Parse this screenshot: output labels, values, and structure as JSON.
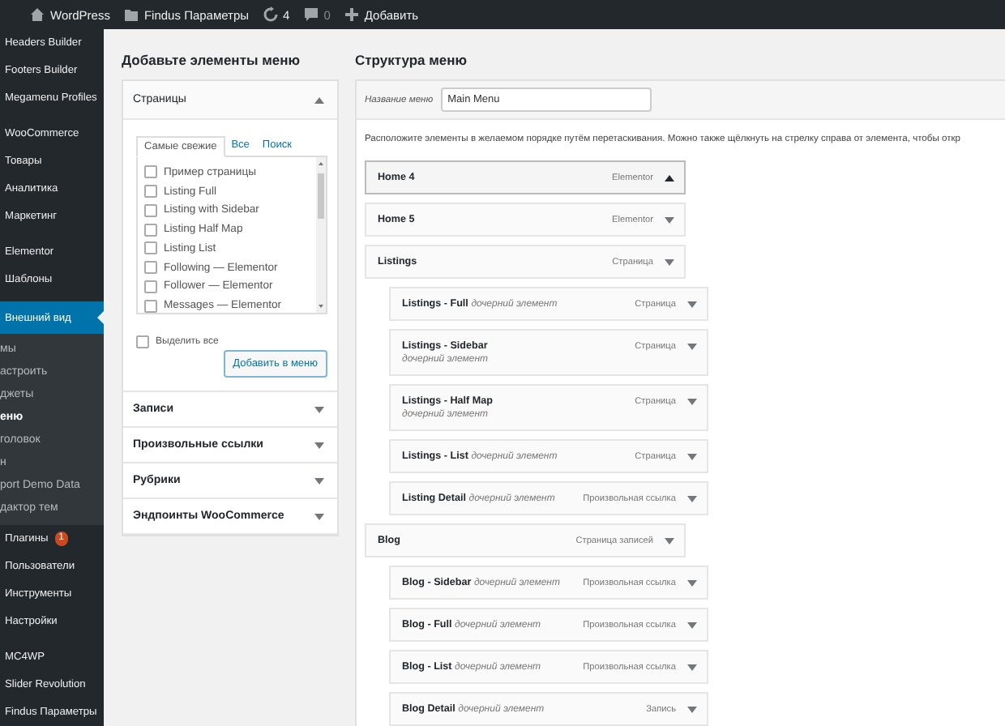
{
  "admin_bar": {
    "items": [
      {
        "kind": "home",
        "label": "WordPress"
      },
      {
        "kind": "site",
        "label": "Findus Параметры"
      },
      {
        "kind": "updates",
        "label": "4"
      },
      {
        "kind": "comments",
        "label": "0"
      },
      {
        "kind": "new",
        "label": "Добавить"
      }
    ]
  },
  "sidebar": {
    "groups": [
      {
        "items": [
          {
            "label": "Headers Builder",
            "selected": false
          },
          {
            "label": "Footers Builder",
            "selected": false
          },
          {
            "label": "Megamenu Profiles",
            "selected": false
          }
        ]
      },
      {
        "items": [
          {
            "label": "WooCommerce",
            "selected": false
          },
          {
            "label": "Товары",
            "selected": false
          },
          {
            "label": "Аналитика",
            "selected": false
          },
          {
            "label": "Маркетинг",
            "selected": false
          }
        ]
      },
      {
        "items": [
          {
            "label": "Elementor",
            "selected": false
          },
          {
            "label": "Шаблоны",
            "selected": false
          }
        ]
      },
      {
        "items": [
          {
            "label": "Внешний вид",
            "selected": true,
            "children": [
              {
                "label": "мы",
                "selected": false
              },
              {
                "label": "астроить",
                "selected": false
              },
              {
                "label": "джеты",
                "selected": false
              },
              {
                "label": "еню",
                "selected": true
              },
              {
                "label": "головок",
                "selected": false
              },
              {
                "label": "н",
                "selected": false
              },
              {
                "label": "port Demo Data",
                "selected": false
              },
              {
                "label": "дактор тем",
                "selected": false
              }
            ]
          },
          {
            "label": "Плагины",
            "selected": false,
            "badge": "1"
          },
          {
            "label": "Пользователи",
            "selected": false
          },
          {
            "label": "Инструменты",
            "selected": false
          },
          {
            "label": "Настройки",
            "selected": false
          }
        ]
      },
      {
        "items": [
          {
            "label": "MC4WP",
            "selected": false
          },
          {
            "label": "Slider Revolution",
            "selected": false
          },
          {
            "label": "Findus Параметры",
            "selected": false
          }
        ]
      }
    ]
  },
  "add_items": {
    "title": "Добавьте элементы меню",
    "sections": [
      {
        "title": "Страницы",
        "expanded": true,
        "tabs": [
          {
            "label": "Самые свежие",
            "selected": true
          },
          {
            "label": "Все",
            "selected": false
          },
          {
            "label": "Поиск",
            "selected": false
          }
        ],
        "pages": [
          {
            "label": "Пример страницы",
            "checked": false
          },
          {
            "label": "Listing Full",
            "checked": false
          },
          {
            "label": "Listing with Sidebar",
            "checked": false
          },
          {
            "label": "Listing Half Map",
            "checked": false
          },
          {
            "label": "Listing List",
            "checked": false
          },
          {
            "label": "Following — Elementor",
            "checked": false
          },
          {
            "label": "Follower — Elementor",
            "checked": false
          },
          {
            "label": "Messages — Elementor",
            "checked": false
          }
        ],
        "select_all": {
          "label": "Выделить все",
          "checked": false
        },
        "button": "Добавить в меню"
      },
      {
        "title": "Записи",
        "expanded": false
      },
      {
        "title": "Произвольные ссылки",
        "expanded": false
      },
      {
        "title": "Рубрики",
        "expanded": false
      },
      {
        "title": "Эндпоинты WooCommerce",
        "expanded": false
      }
    ]
  },
  "structure": {
    "title": "Структура меню",
    "name_label": "Название меню",
    "name_value": "Main Menu",
    "instructions": "Расположите элементы в желаемом порядке путём перетаскивания. Можно также щёлкнуть на стрелку справа от элемента, чтобы откр",
    "items": [
      {
        "title": "Home 4",
        "type": "Elementor",
        "active": true
      },
      {
        "title": "Home 5",
        "type": "Elementor",
        "active": false
      },
      {
        "title": "Listings",
        "type": "Страница",
        "active": false,
        "children": [
          {
            "title": "Listings - Full",
            "sub": "дочерний элемент",
            "type": "Страница",
            "active": false
          },
          {
            "title": "Listings - Sidebar",
            "sub": "дочерний элемент",
            "type": "Страница",
            "active": false
          },
          {
            "title": "Listings - Half Map",
            "sub": "дочерний элемент",
            "type": "Страница",
            "active": false
          },
          {
            "title": "Listings - List",
            "sub": "дочерний элемент",
            "type": "Страница",
            "active": false
          },
          {
            "title": "Listing Detail",
            "sub": "дочерний элемент",
            "type": "Произвольная ссылка",
            "active": false
          }
        ]
      },
      {
        "title": "Blog",
        "type": "Страница записей",
        "active": false,
        "children": [
          {
            "title": "Blog - Sidebar",
            "sub": "дочерний элемент",
            "type": "Произвольная ссылка",
            "active": false
          },
          {
            "title": "Blog - Full",
            "sub": "дочерний элемент",
            "type": "Произвольная ссылка",
            "active": false
          },
          {
            "title": "Blog - List",
            "sub": "дочерний элемент",
            "type": "Произвольная ссылка",
            "active": false
          },
          {
            "title": "Blog Detail",
            "sub": "дочерний элемент",
            "type": "Запись",
            "active": false
          }
        ]
      }
    ]
  }
}
